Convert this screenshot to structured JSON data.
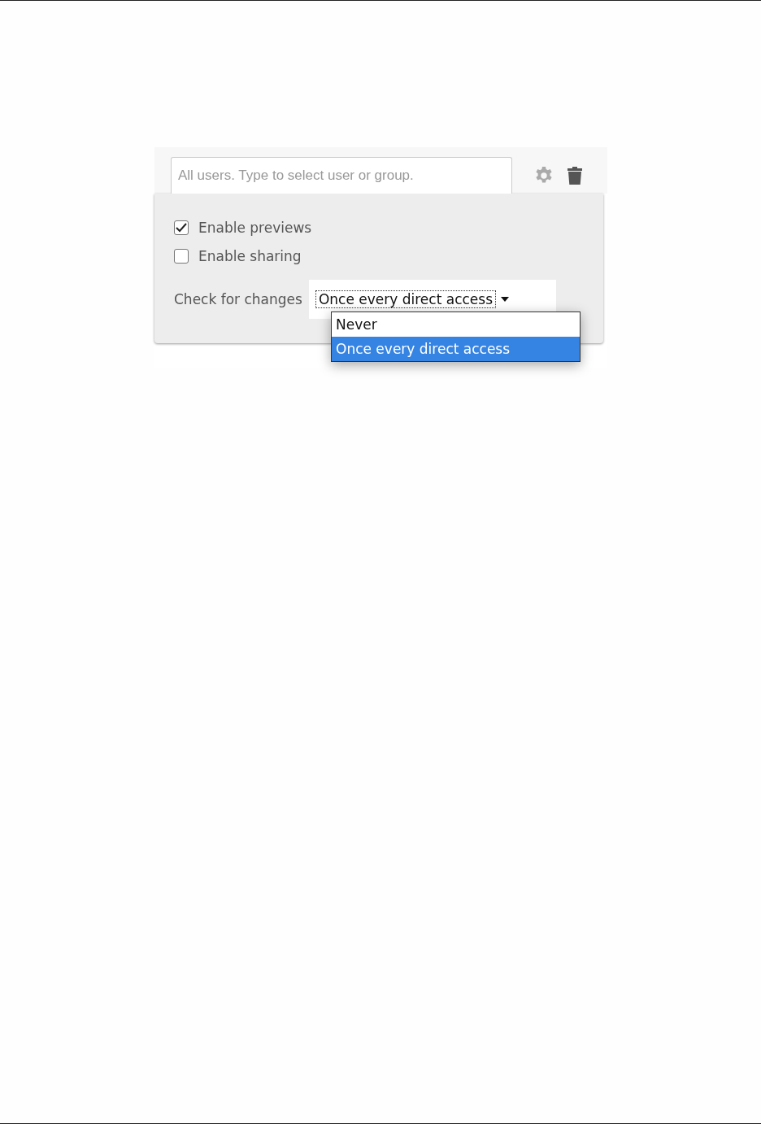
{
  "search": {
    "placeholder": "All users. Type to select user or group."
  },
  "options": [
    {
      "label": "Enable previews",
      "checked": true
    },
    {
      "label": "Enable sharing",
      "checked": false
    }
  ],
  "check_for_changes": {
    "label": "Check for changes",
    "value": "Once every direct access",
    "expanded": true,
    "options": [
      {
        "label": "Never",
        "selected": false
      },
      {
        "label": "Once every direct access",
        "selected": true
      }
    ]
  }
}
